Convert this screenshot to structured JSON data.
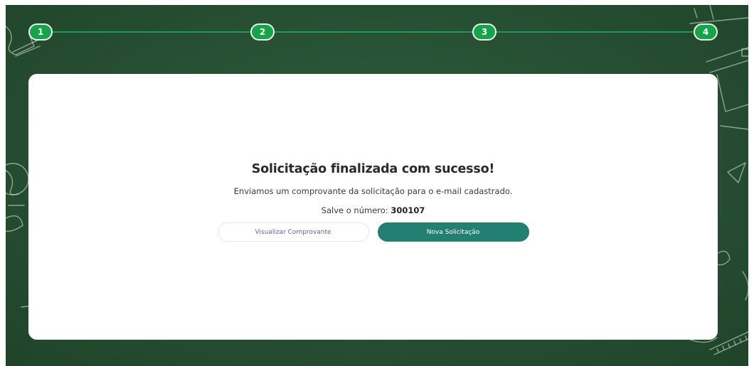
{
  "stepper": {
    "steps": [
      {
        "label": "1"
      },
      {
        "label": "2"
      },
      {
        "label": "3"
      },
      {
        "label": "4"
      }
    ]
  },
  "success": {
    "title": "Solicitação finalizada com sucesso!",
    "message": "Enviamos um comprovante da solicitação para o e-mail cadastrado.",
    "number_prefix": "Salve o número:",
    "number": "300107"
  },
  "actions": {
    "view_receipt": "Visualizar Comprovante",
    "new_request": "Nova Solicitação"
  },
  "colors": {
    "board": "#274f33",
    "step": "#16a34a",
    "primary_button": "#227f72"
  }
}
